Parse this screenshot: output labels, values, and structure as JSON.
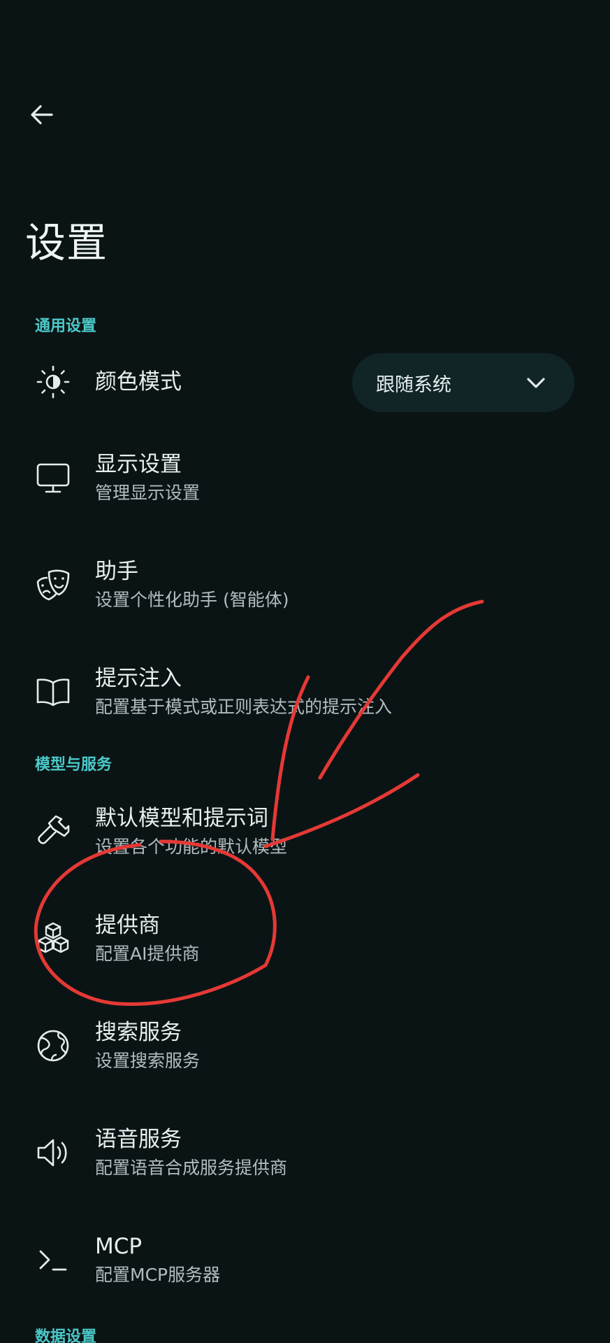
{
  "header": {
    "back_icon": "arrow-left-icon",
    "title": "设置"
  },
  "sections": {
    "general": "通用设置",
    "models": "模型与服务",
    "data": "数据设置"
  },
  "color_mode": {
    "title": "颜色模式",
    "icon": "brightness-icon",
    "dropdown_value": "跟随系统"
  },
  "items": {
    "display": {
      "title": "显示设置",
      "subtitle": "管理显示设置",
      "icon": "monitor-icon"
    },
    "assistant": {
      "title": "助手",
      "subtitle": "设置个性化助手 (智能体)",
      "icon": "theater-mask-icon"
    },
    "prompt_injection": {
      "title": "提示注入",
      "subtitle": "配置基于模式或正则表达式的提示注入",
      "icon": "book-icon"
    },
    "default_model": {
      "title": "默认模型和提示词",
      "subtitle": "设置各个功能的默认模型",
      "icon": "hammer-icon"
    },
    "providers": {
      "title": "提供商",
      "subtitle": "配置AI提供商",
      "icon": "cubes-icon"
    },
    "search": {
      "title": "搜索服务",
      "subtitle": "设置搜索服务",
      "icon": "globe-icon"
    },
    "voice": {
      "title": "语音服务",
      "subtitle": "配置语音合成服务提供商",
      "icon": "speaker-icon"
    },
    "mcp": {
      "title": "MCP",
      "subtitle": "配置MCP服务器",
      "icon": "terminal-icon"
    }
  },
  "colors": {
    "background": "#0b1415",
    "accent": "#4cc9c9",
    "annotation": "#e53935"
  }
}
